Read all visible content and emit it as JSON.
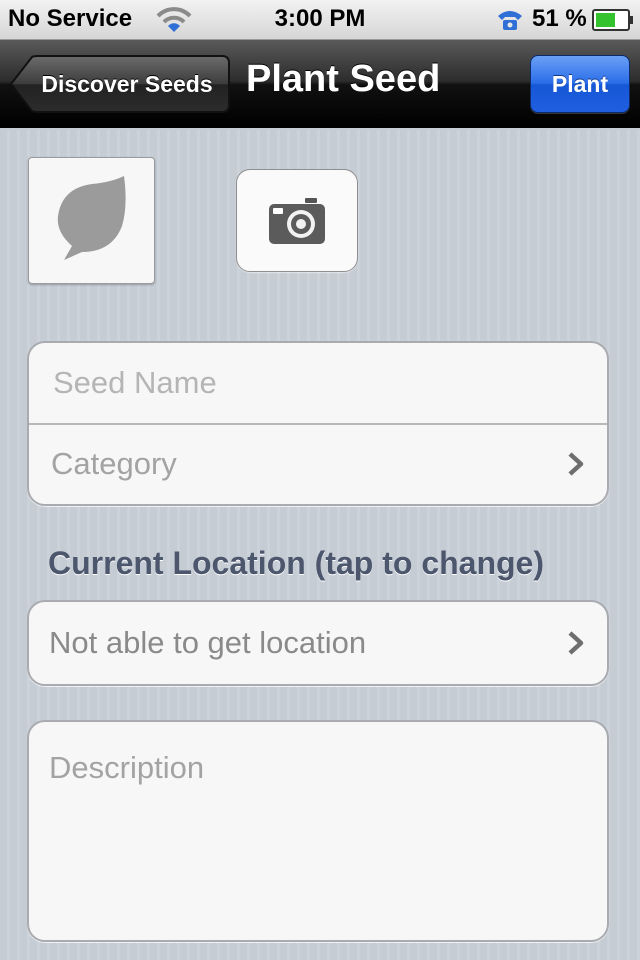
{
  "status_bar": {
    "carrier": "No Service",
    "time": "3:00 PM",
    "battery_percent": "51 %",
    "wifi_icon": "wifi-icon",
    "phone_icon": "phone-icon",
    "battery_icon": "battery-icon"
  },
  "nav": {
    "back_label": "Discover Seeds",
    "title": "Plant Seed",
    "action_label": "Plant"
  },
  "media": {
    "seed_image_icon": "leaf-icon",
    "camera_icon": "camera-icon"
  },
  "form": {
    "seed_name_placeholder": "Seed Name",
    "seed_name_value": "",
    "category_label": "Category",
    "location_header": "Current Location (tap to change)",
    "location_value": "Not able to get location",
    "description_placeholder": "Description"
  },
  "colors": {
    "accent_blue": "#2b6ee8",
    "nav_black": "#000000",
    "background": "#c5ccd4",
    "section_header": "#4c566c"
  }
}
